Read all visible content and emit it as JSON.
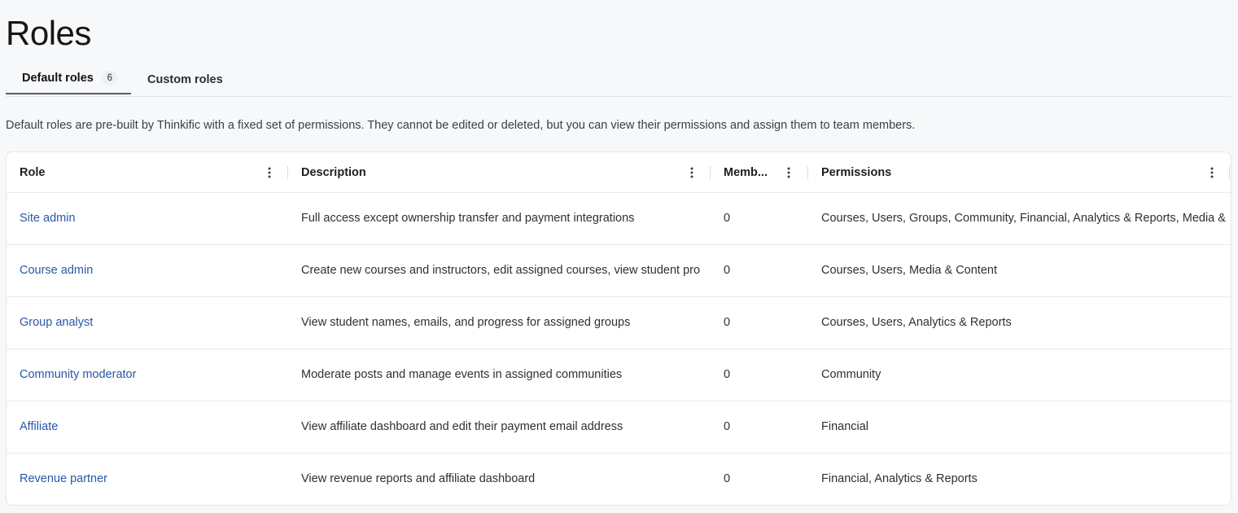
{
  "page": {
    "title": "Roles",
    "intro": "Default roles are pre-built by Thinkific with a fixed set of permissions. They cannot be edited or deleted, but you can view their permissions and assign them to team members."
  },
  "tabs": [
    {
      "label": "Default roles",
      "count": "6",
      "active": true
    },
    {
      "label": "Custom roles",
      "active": false
    }
  ],
  "table": {
    "columns": [
      {
        "label": "Role"
      },
      {
        "label": "Description"
      },
      {
        "label": "Memb..."
      },
      {
        "label": "Permissions"
      }
    ],
    "rows": [
      {
        "role": "Site admin",
        "description": "Full access except ownership transfer and payment integrations",
        "members": "0",
        "permissions": "Courses, Users, Groups, Community, Financial, Analytics & Reports, Media &"
      },
      {
        "role": "Course admin",
        "description": "Create new courses and instructors, edit assigned courses, view student pro",
        "members": "0",
        "permissions": "Courses, Users, Media & Content"
      },
      {
        "role": "Group analyst",
        "description": "View student names, emails, and progress for assigned groups",
        "members": "0",
        "permissions": "Courses, Users, Analytics & Reports"
      },
      {
        "role": "Community moderator",
        "description": "Moderate posts and manage events in assigned communities",
        "members": "0",
        "permissions": "Community"
      },
      {
        "role": "Affiliate",
        "description": "View affiliate dashboard and edit their payment email address",
        "members": "0",
        "permissions": "Financial"
      },
      {
        "role": "Revenue partner",
        "description": "View revenue reports and affiliate dashboard",
        "members": "0",
        "permissions": "Financial, Analytics & Reports"
      }
    ]
  },
  "icons": {
    "column_menu": "more-vertical-icon"
  },
  "colors": {
    "link": "#2957a6",
    "background": "#f7f8fa",
    "card": "#ffffff"
  }
}
